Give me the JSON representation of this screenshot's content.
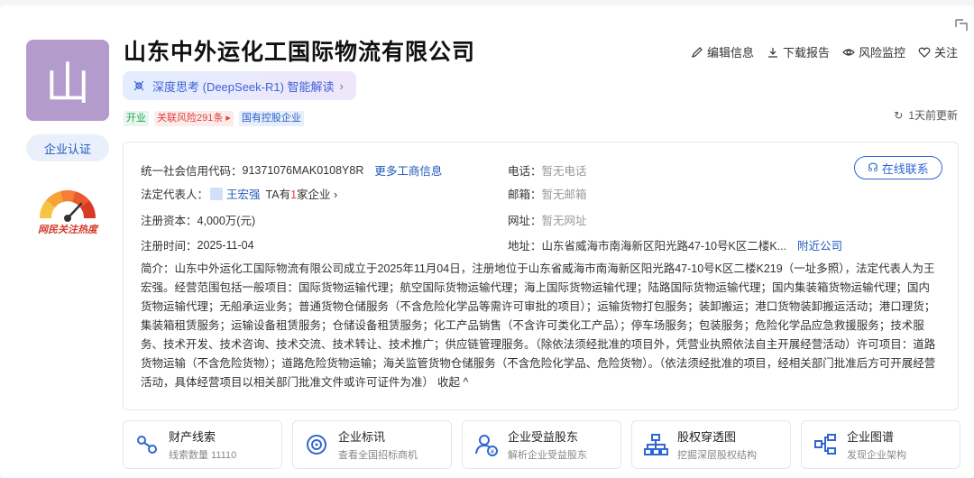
{
  "company": {
    "logo_char": "山",
    "name": "山东中外运化工国际物流有限公司",
    "certify_label": "企业认证",
    "heat_label": "网民关注热度"
  },
  "ai": {
    "label": "深度思考 (DeepSeek-R1) 智能解读"
  },
  "tags": {
    "status": "开业",
    "risk": "关联风险291条",
    "type": "国有控股企业"
  },
  "actions": {
    "edit": "编辑信息",
    "download": "下载报告",
    "monitor": "风险监控",
    "follow": "关注"
  },
  "update": {
    "label": "1天前更新"
  },
  "info": {
    "credit_label": "统一社会信用代码：",
    "credit_value": "91371076MAK0108Y8R",
    "more_link": "更多工商信息",
    "phone_label": "电话：",
    "phone_value": "暂无电话",
    "contact_button": "在线联系",
    "legal_label": "法定代表人：",
    "legal_name": "王宏强",
    "legal_ta_prefix": "TA有",
    "legal_ta_count": "1",
    "legal_ta_suffix": "家企业",
    "email_label": "邮箱：",
    "email_value": "暂无邮箱",
    "capital_label": "注册资本：",
    "capital_value": "4,000万(元)",
    "website_label": "网址：",
    "website_value": "暂无网址",
    "reg_time_label": "注册时间：",
    "reg_time_value": "2025-11-04",
    "address_label": "地址：",
    "address_value": "山东省威海市南海新区阳光路47-10号K区二楼K...",
    "nearby_link": "附近公司",
    "desc_label": "简介：",
    "desc_text": "山东中外运化工国际物流有限公司成立于2025年11月04日，注册地位于山东省威海市南海新区阳光路47-10号K区二楼K219（一址多照），法定代表人为王宏强。经营范围包括一般项目：国际货物运输代理；航空国际货物运输代理；海上国际货物运输代理；陆路国际货物运输代理；国内集装箱货物运输代理；国内货物运输代理；无船承运业务；普通货物仓储服务（不含危险化学品等需许可审批的项目）；运输货物打包服务；装卸搬运；港口货物装卸搬运活动；港口理货；集装箱租赁服务；运输设备租赁服务；仓储设备租赁服务；化工产品销售（不含许可类化工产品）；停车场服务；包装服务；危险化学品应急救援服务；技术服务、技术开发、技术咨询、技术交流、技术转让、技术推广；供应链管理服务。（除依法须经批准的项目外，凭营业执照依法自主开展经营活动）许可项目：道路货物运输（不含危险货物）；道路危险货物运输；海关监管货物仓储服务（不含危险化学品、危险货物）。（依法须经批准的项目，经相关部门批准后方可开展经营活动，具体经营项目以相关部门批准文件或许可证件为准）",
    "collapse": "收起 ^"
  },
  "cards": [
    {
      "title": "财产线索",
      "sub": "线索数量 11110"
    },
    {
      "title": "企业标讯",
      "sub": "查看全国招标商机"
    },
    {
      "title": "企业受益股东",
      "sub": "解析企业受益股东"
    },
    {
      "title": "股权穿透图",
      "sub": "挖掘深层股权结构"
    },
    {
      "title": "企业图谱",
      "sub": "发现企业架构"
    }
  ],
  "colors": {
    "accent": "#1f59b8",
    "logo_bg": "#b39ccc",
    "risk": "#e0413c",
    "status": "#24a257"
  }
}
